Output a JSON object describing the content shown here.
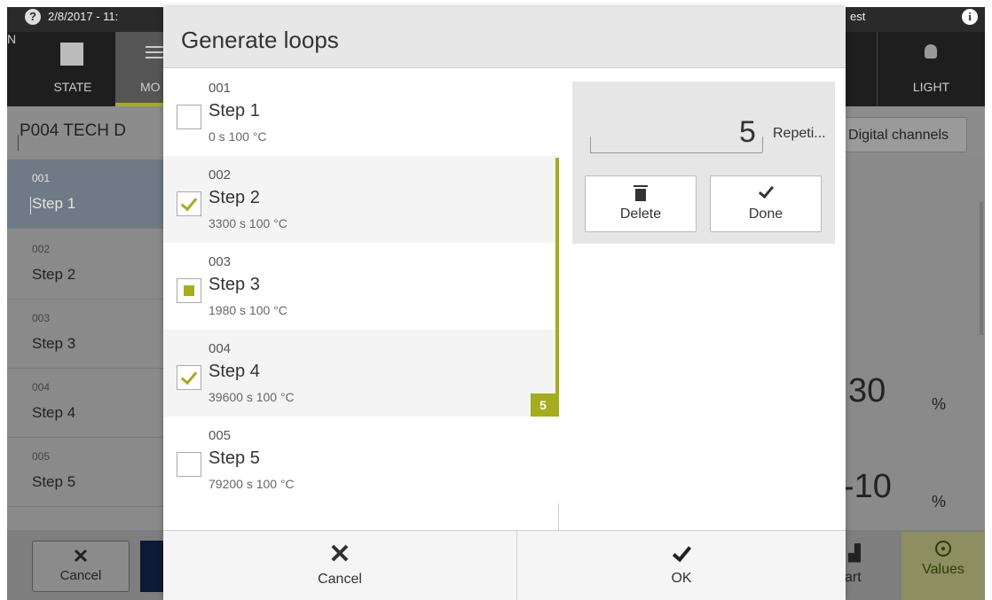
{
  "background": {
    "topbar": {
      "datetime": "2/8/2017 - 11:",
      "right_text": "est"
    },
    "nav": {
      "state": "STATE",
      "mode": "MO",
      "n_fragment": "N",
      "light": "LIGHT"
    },
    "program_name": "P004 TECH D",
    "digital_channels": "Digital channels",
    "steps": [
      {
        "num": "001",
        "name": "Step 1"
      },
      {
        "num": "002",
        "name": "Step 2"
      },
      {
        "num": "003",
        "name": "Step 3"
      },
      {
        "num": "004",
        "name": "Step 4"
      },
      {
        "num": "005",
        "name": "Step 5"
      }
    ],
    "value1": "30",
    "unit1": "%",
    "value2": "-10",
    "unit2": "%",
    "cancel": "Cancel",
    "chart": "art",
    "values": "Values"
  },
  "dialog": {
    "title": "Generate loops",
    "items": [
      {
        "num": "001",
        "name": "Step 1",
        "detail": "0 s  100 °C",
        "state": "unchecked"
      },
      {
        "num": "002",
        "name": "Step 2",
        "detail": "3300 s  100 °C",
        "state": "checked"
      },
      {
        "num": "003",
        "name": "Step 3",
        "detail": "1980 s  100 °C",
        "state": "partial"
      },
      {
        "num": "004",
        "name": "Step 4",
        "detail": "39600 s  100 °C",
        "state": "checked"
      },
      {
        "num": "005",
        "name": "Step 5",
        "detail": "79200 s  100 °C",
        "state": "unchecked"
      }
    ],
    "loop_badge": "5",
    "repetitions_value": "5",
    "repetitions_label": "Repeti...",
    "delete_label": "Delete",
    "done_label": "Done",
    "cancel_label": "Cancel",
    "ok_label": "OK",
    "accent_color": "#a4ad1e"
  }
}
